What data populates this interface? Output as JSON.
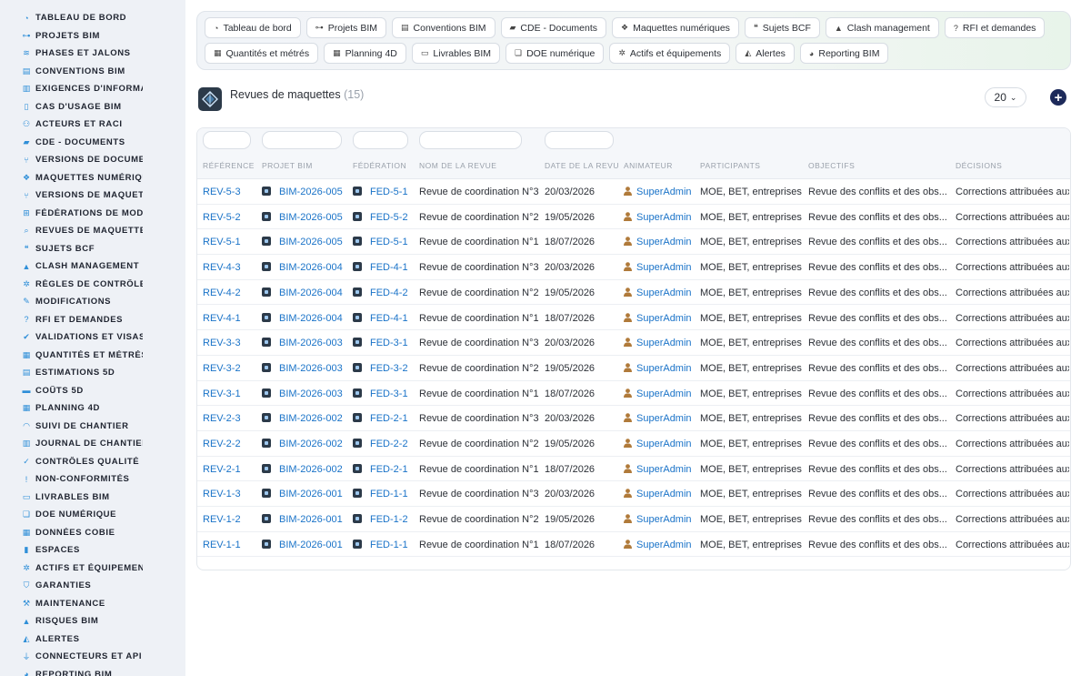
{
  "sidebar": {
    "items": [
      {
        "label": "TABLEAU DE BORD",
        "icon": "dashboard-icon"
      },
      {
        "label": "PROJETS BIM",
        "icon": "project-diagram-icon"
      },
      {
        "label": "PHASES ET JALONS",
        "icon": "layers-icon"
      },
      {
        "label": "CONVENTIONS BIM",
        "icon": "book-icon"
      },
      {
        "label": "EXIGENCES D'INFORMATION",
        "icon": "clipboard-icon"
      },
      {
        "label": "CAS D'USAGE BIM",
        "icon": "file-icon"
      },
      {
        "label": "ACTEURS ET RACI",
        "icon": "users-icon"
      },
      {
        "label": "CDE - DOCUMENTS",
        "icon": "folder-open-icon"
      },
      {
        "label": "VERSIONS DE DOCUMENTS",
        "icon": "code-branch-icon"
      },
      {
        "label": "MAQUETTES NUMÉRIQUES",
        "icon": "cubes-icon"
      },
      {
        "label": "VERSIONS DE MAQUETTES",
        "icon": "code-branch-icon"
      },
      {
        "label": "FÉDÉRATIONS DE MODÈLES",
        "icon": "sitemap-icon"
      },
      {
        "label": "REVUES DE MAQUETTES",
        "icon": "search-icon"
      },
      {
        "label": "SUJETS BCF",
        "icon": "comments-icon"
      },
      {
        "label": "CLASH MANAGEMENT",
        "icon": "warning-icon"
      },
      {
        "label": "RÈGLES DE CONTRÔLE",
        "icon": "cogs-icon"
      },
      {
        "label": "MODIFICATIONS",
        "icon": "edit-icon"
      },
      {
        "label": "RFI ET DEMANDES",
        "icon": "question-circle-icon"
      },
      {
        "label": "VALIDATIONS ET VISAS",
        "icon": "check-double-icon"
      },
      {
        "label": "QUANTITÉS ET MÉTRÉS",
        "icon": "calculator-icon"
      },
      {
        "label": "ESTIMATIONS 5D",
        "icon": "file-invoice-icon"
      },
      {
        "label": "COÛTS 5D",
        "icon": "money-bill-icon"
      },
      {
        "label": "PLANNING 4D",
        "icon": "calendar-icon"
      },
      {
        "label": "SUIVI DE CHANTIER",
        "icon": "hard-hat-icon"
      },
      {
        "label": "JOURNAL DE CHANTIER",
        "icon": "clipboard-icon"
      },
      {
        "label": "CONTRÔLES QUALITÉ",
        "icon": "check-circle-icon"
      },
      {
        "label": "NON-CONFORMITÉS",
        "icon": "exclamation-circle-icon"
      },
      {
        "label": "LIVRABLES BIM",
        "icon": "archive-icon"
      },
      {
        "label": "DOE NUMÉRIQUE",
        "icon": "book-open-icon"
      },
      {
        "label": "DONNÉES COBIE",
        "icon": "table-icon"
      },
      {
        "label": "ESPACES",
        "icon": "building-icon"
      },
      {
        "label": "ACTIFS ET ÉQUIPEMENTS",
        "icon": "cogs-icon"
      },
      {
        "label": "GARANTIES",
        "icon": "shield-icon"
      },
      {
        "label": "MAINTENANCE",
        "icon": "wrench-icon"
      },
      {
        "label": "RISQUES BIM",
        "icon": "warning-icon"
      },
      {
        "label": "ALERTES",
        "icon": "bell-icon"
      },
      {
        "label": "CONNECTEURS ET API",
        "icon": "plug-icon"
      },
      {
        "label": "REPORTING BIM",
        "icon": "chart-pie-icon"
      }
    ]
  },
  "quicknav": [
    {
      "label": "Tableau de bord",
      "icon": "dashboard-icon"
    },
    {
      "label": "Projets BIM",
      "icon": "project-diagram-icon"
    },
    {
      "label": "Conventions BIM",
      "icon": "book-icon"
    },
    {
      "label": "CDE - Documents",
      "icon": "folder-open-icon"
    },
    {
      "label": "Maquettes numériques",
      "icon": "cubes-icon"
    },
    {
      "label": "Sujets BCF",
      "icon": "comments-icon"
    },
    {
      "label": "Clash management",
      "icon": "warning-icon"
    },
    {
      "label": "RFI et demandes",
      "icon": "question-circle-icon"
    },
    {
      "label": "Quantités et métrés",
      "icon": "calculator-icon"
    },
    {
      "label": "Planning 4D",
      "icon": "calendar-icon"
    },
    {
      "label": "Livrables BIM",
      "icon": "archive-icon"
    },
    {
      "label": "DOE numérique",
      "icon": "book-open-icon"
    },
    {
      "label": "Actifs et équipements",
      "icon": "cogs-icon"
    },
    {
      "label": "Alertes",
      "icon": "bell-icon"
    },
    {
      "label": "Reporting BIM",
      "icon": "chart-pie-icon"
    }
  ],
  "section": {
    "title": "Revues de maquettes",
    "count": "(15)",
    "page_size": "20"
  },
  "table": {
    "columns": [
      "RÉFÉRENCE",
      "PROJET BIM",
      "FÉDÉRATION",
      "NOM DE LA REVUE",
      "DATE DE LA REVUE",
      "ANIMATEUR",
      "PARTICIPANTS",
      "OBJECTIFS",
      "DÉCISIONS"
    ],
    "rows": [
      {
        "ref": "REV-5-3",
        "projet": "BIM-2026-005",
        "federation": "FED-5-1",
        "nom": "Revue de coordination N°3",
        "date": "20/03/2026",
        "animateur": "SuperAdmin",
        "participants": "MOE, BET, entreprises",
        "objectifs": "Revue des conflits et des obs...",
        "decisions": "Corrections attribuées aux"
      },
      {
        "ref": "REV-5-2",
        "projet": "BIM-2026-005",
        "federation": "FED-5-2",
        "nom": "Revue de coordination N°2",
        "date": "19/05/2026",
        "animateur": "SuperAdmin",
        "participants": "MOE, BET, entreprises",
        "objectifs": "Revue des conflits et des obs...",
        "decisions": "Corrections attribuées aux"
      },
      {
        "ref": "REV-5-1",
        "projet": "BIM-2026-005",
        "federation": "FED-5-1",
        "nom": "Revue de coordination N°1",
        "date": "18/07/2026",
        "animateur": "SuperAdmin",
        "participants": "MOE, BET, entreprises",
        "objectifs": "Revue des conflits et des obs...",
        "decisions": "Corrections attribuées aux"
      },
      {
        "ref": "REV-4-3",
        "projet": "BIM-2026-004",
        "federation": "FED-4-1",
        "nom": "Revue de coordination N°3",
        "date": "20/03/2026",
        "animateur": "SuperAdmin",
        "participants": "MOE, BET, entreprises",
        "objectifs": "Revue des conflits et des obs...",
        "decisions": "Corrections attribuées aux"
      },
      {
        "ref": "REV-4-2",
        "projet": "BIM-2026-004",
        "federation": "FED-4-2",
        "nom": "Revue de coordination N°2",
        "date": "19/05/2026",
        "animateur": "SuperAdmin",
        "participants": "MOE, BET, entreprises",
        "objectifs": "Revue des conflits et des obs...",
        "decisions": "Corrections attribuées aux"
      },
      {
        "ref": "REV-4-1",
        "projet": "BIM-2026-004",
        "federation": "FED-4-1",
        "nom": "Revue de coordination N°1",
        "date": "18/07/2026",
        "animateur": "SuperAdmin",
        "participants": "MOE, BET, entreprises",
        "objectifs": "Revue des conflits et des obs...",
        "decisions": "Corrections attribuées aux"
      },
      {
        "ref": "REV-3-3",
        "projet": "BIM-2026-003",
        "federation": "FED-3-1",
        "nom": "Revue de coordination N°3",
        "date": "20/03/2026",
        "animateur": "SuperAdmin",
        "participants": "MOE, BET, entreprises",
        "objectifs": "Revue des conflits et des obs...",
        "decisions": "Corrections attribuées aux"
      },
      {
        "ref": "REV-3-2",
        "projet": "BIM-2026-003",
        "federation": "FED-3-2",
        "nom": "Revue de coordination N°2",
        "date": "19/05/2026",
        "animateur": "SuperAdmin",
        "participants": "MOE, BET, entreprises",
        "objectifs": "Revue des conflits et des obs...",
        "decisions": "Corrections attribuées aux"
      },
      {
        "ref": "REV-3-1",
        "projet": "BIM-2026-003",
        "federation": "FED-3-1",
        "nom": "Revue de coordination N°1",
        "date": "18/07/2026",
        "animateur": "SuperAdmin",
        "participants": "MOE, BET, entreprises",
        "objectifs": "Revue des conflits et des obs...",
        "decisions": "Corrections attribuées aux"
      },
      {
        "ref": "REV-2-3",
        "projet": "BIM-2026-002",
        "federation": "FED-2-1",
        "nom": "Revue de coordination N°3",
        "date": "20/03/2026",
        "animateur": "SuperAdmin",
        "participants": "MOE, BET, entreprises",
        "objectifs": "Revue des conflits et des obs...",
        "decisions": "Corrections attribuées aux"
      },
      {
        "ref": "REV-2-2",
        "projet": "BIM-2026-002",
        "federation": "FED-2-2",
        "nom": "Revue de coordination N°2",
        "date": "19/05/2026",
        "animateur": "SuperAdmin",
        "participants": "MOE, BET, entreprises",
        "objectifs": "Revue des conflits et des obs...",
        "decisions": "Corrections attribuées aux"
      },
      {
        "ref": "REV-2-1",
        "projet": "BIM-2026-002",
        "federation": "FED-2-1",
        "nom": "Revue de coordination N°1",
        "date": "18/07/2026",
        "animateur": "SuperAdmin",
        "participants": "MOE, BET, entreprises",
        "objectifs": "Revue des conflits et des obs...",
        "decisions": "Corrections attribuées aux"
      },
      {
        "ref": "REV-1-3",
        "projet": "BIM-2026-001",
        "federation": "FED-1-1",
        "nom": "Revue de coordination N°3",
        "date": "20/03/2026",
        "animateur": "SuperAdmin",
        "participants": "MOE, BET, entreprises",
        "objectifs": "Revue des conflits et des obs...",
        "decisions": "Corrections attribuées aux"
      },
      {
        "ref": "REV-1-2",
        "projet": "BIM-2026-001",
        "federation": "FED-1-2",
        "nom": "Revue de coordination N°2",
        "date": "19/05/2026",
        "animateur": "SuperAdmin",
        "participants": "MOE, BET, entreprises",
        "objectifs": "Revue des conflits et des obs...",
        "decisions": "Corrections attribuées aux"
      },
      {
        "ref": "REV-1-1",
        "projet": "BIM-2026-001",
        "federation": "FED-1-1",
        "nom": "Revue de coordination N°1",
        "date": "18/07/2026",
        "animateur": "SuperAdmin",
        "participants": "MOE, BET, entreprises",
        "objectifs": "Revue des conflits et des obs...",
        "decisions": "Corrections attribuées aux"
      }
    ]
  },
  "colors": {
    "accent": "#1a73c8",
    "sidebar_icon": "#2f8fd8",
    "sidebar_bg": "#eef1f6",
    "add_button": "#1d2a5a",
    "animateur_icon": "#b07a3a"
  }
}
